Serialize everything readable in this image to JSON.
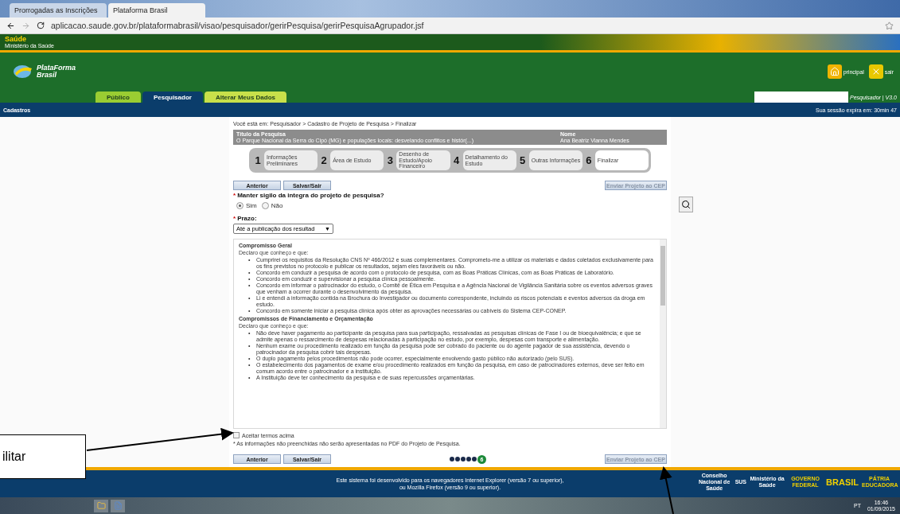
{
  "browser": {
    "tabs": [
      {
        "title": "Prorrogadas as Inscrições",
        "selected": false
      },
      {
        "title": "Plataforma Brasil",
        "selected": true
      }
    ],
    "url": "aplicacao.saude.gov.br/plataformabrasil/visao/pesquisador/gerirPesquisa/gerirPesquisaAgrupador.jsf"
  },
  "gov_bar": {
    "title": "Saúde",
    "subtitle": "Ministério da Saúde"
  },
  "header": {
    "logo_line1": "PlataForma",
    "logo_line2": "Brasil",
    "links": [
      {
        "kind": "home",
        "label": "principal"
      },
      {
        "kind": "exit",
        "label": "sair"
      }
    ],
    "nav_tabs": [
      {
        "label": "Público",
        "selected": false,
        "color": "#9acd32"
      },
      {
        "label": "Pesquisador",
        "selected": true,
        "color": "#0b3d6b"
      },
      {
        "label": "Alterar Meus Dados",
        "selected": false,
        "color": "#c8e04a"
      }
    ],
    "user": "Pesquisador | V3.0"
  },
  "menu_bar": {
    "item": "Cadastros",
    "session": "Sua sessão expira em: 30min 47"
  },
  "breadcrumb": "Você está em: Pesquisador > Cadastro de Projeto de Pesquisa > Finalizar",
  "research": {
    "title_label": "Título da Pesquisa",
    "title": "O Parque Nacional da Serra do Cipó (MG) e populações locais: desvelando conflitos e histór(...)",
    "name_label": "Nome",
    "name": "Ana Beatriz Vianna Mendes"
  },
  "steps": [
    {
      "number": "1",
      "label": "Informações Preliminares",
      "selected": false
    },
    {
      "number": "2",
      "label": "Área de Estudo",
      "selected": false
    },
    {
      "number": "3",
      "label": "Desenho de Estudo/Apoio Financeiro",
      "selected": false
    },
    {
      "number": "4",
      "label": "Detalhamento do Estudo",
      "selected": false
    },
    {
      "number": "5",
      "label": "Outras Informações",
      "selected": false
    },
    {
      "number": "6",
      "label": "Finalizar",
      "selected": true
    }
  ],
  "top_buttons": [
    "Anterior",
    "Salvar/Sair"
  ],
  "send_button_top": "Enviar Projeto ao CEP",
  "question": {
    "required": "*",
    "label": "Manter sigilo da integra do projeto de pesquisa?",
    "options": [
      {
        "label": "Sim",
        "selected": true
      },
      {
        "label": "Não",
        "selected": false
      }
    ]
  },
  "deadline": {
    "required": "*",
    "label": "Prazo:",
    "value": "Até a publicação dos resultad",
    "caret": "▼"
  },
  "terms": [
    {
      "heading": "Compromisso Geral",
      "intro": "Declaro que conheço e que:",
      "bullet": "•",
      "items": [
        "Cumprirei os requisitos da Resolução CNS Nº 466/2012 e suas complementares. Comprometo-me a utilizar os materiais e dados coletados exclusivamente para os fins previstos no protocolo e publicar os resultados, sejam eles favoráveis ou não.",
        "Concordo em conduzir a pesquisa de acordo com o protocolo de pesquisa, com as Boas Práticas Clínicas, com as Boas Práticas de Laboratório.",
        "Concordo em conduzir e supervisionar a pesquisa clínica pessoalmente.",
        "Concordo em informar o patrocinador do estudo, o Comitê de Ética em Pesquisa e a Agência Nacional de Vigilância Sanitária sobre os eventos adversos graves que venham a ocorrer durante o desenvolvimento da pesquisa.",
        "Li e entendi a informação contida na Brochura do Investigador ou documento correspondente, incluindo os riscos potenciais e eventos adversos da droga em estudo.",
        "Concordo em somente iniciar a pesquisa clínica após obter as aprovações necessárias ou cabíveis do Sistema CEP-CONEP."
      ]
    },
    {
      "heading": "Compromissos de Financiamento e Orçamentação",
      "intro": "Declaro que conheço e que:",
      "bullet": "•",
      "items": [
        "Não deve haver pagamento ao participante da pesquisa para sua participação, ressalvadas as pesquisas clínicas de Fase I ou de bioequivalência; e que se admite apenas o ressarcimento de despesas relacionadas à participação no estudo, por exemplo, despesas com transporte e alimentação.",
        "Nenhum exame ou procedimento realizado em função da pesquisa pode ser cobrado do paciente ou do agente pagador de sua assistência, devendo o patrocinador da pesquisa cobrir tais despesas.",
        "O duplo pagamento pelos procedimentos não pode ocorrer, especialmente envolvendo gasto público não autorizado (pelo SUS).",
        "O estabelecimento dos pagamentos de exame e/ou procedimento realizados em função da pesquisa, em caso de patrocinadores externos, deve ser feito em comum acordo entre o patrocinador e a instituição.",
        "A Instituição deve ter conhecimento da pesquisa e de suas repercussões orçamentárias."
      ]
    }
  ],
  "accept": {
    "label": "Aceitar termos acima",
    "checked": false
  },
  "note": "* As informações não preenchidas não serão apresentadas no PDF do Projeto de Pesquisa.",
  "bottom_buttons": [
    "Anterior",
    "Salvar/Sair"
  ],
  "pager": [
    {
      "selected": false
    },
    {
      "selected": false
    },
    {
      "selected": false
    },
    {
      "selected": false
    },
    {
      "selected": false
    },
    {
      "label": "6",
      "selected": true
    }
  ],
  "send_button_bottom": "Enviar Projeto ao CEP",
  "footer": {
    "lines": [
      "Este sistema foi desenvolvido para os navegadores Internet Explorer (versão 7 ou superior),",
      "ou Mozilla Firefox (versão 9 ou superior)."
    ],
    "logos": [
      "Conselho Nacional de Saúde",
      "SUS",
      "Ministério da Saúde",
      "GOVERNO FEDERAL",
      "BRASIL",
      "PÁTRIA EDUCADORA"
    ]
  },
  "taskbar": {
    "language": "PT",
    "time": "16:46",
    "date": "01/09/2015"
  },
  "annotation": {
    "text": "ilitar"
  }
}
